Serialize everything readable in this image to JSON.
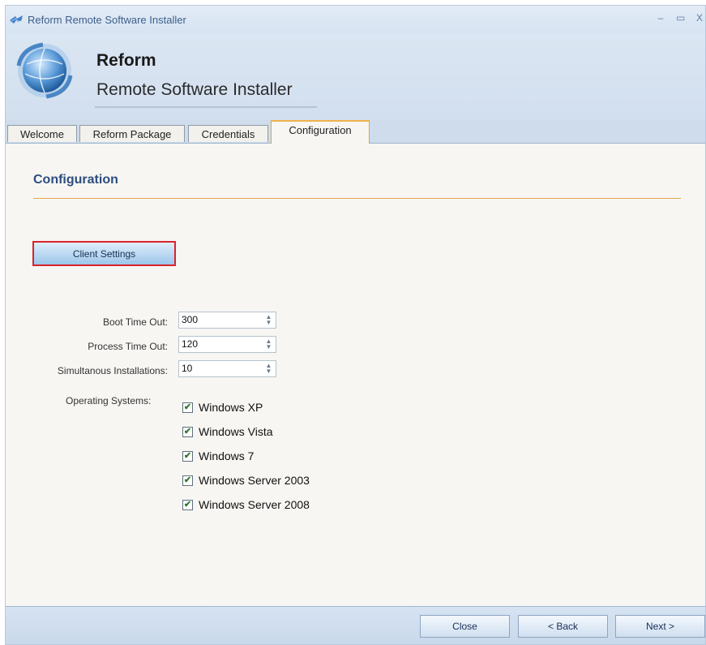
{
  "window": {
    "title": "Reform Remote Software Installer",
    "controls": {
      "minimize": "–",
      "maximize": "▭",
      "close": "X"
    }
  },
  "banner": {
    "app_name": "Reform",
    "subtitle": "Remote Software Installer"
  },
  "tabs": [
    {
      "label": "Welcome",
      "active": false
    },
    {
      "label": "Reform Package",
      "active": false
    },
    {
      "label": "Credentials",
      "active": false
    },
    {
      "label": "Configuration",
      "active": true
    }
  ],
  "page": {
    "title": "Configuration",
    "client_settings_label": "Client Settings"
  },
  "fields": {
    "boot_timeout": {
      "label": "Boot Time Out:",
      "value": "300"
    },
    "process_timeout": {
      "label": "Process Time Out:",
      "value": "120"
    },
    "simultaneous": {
      "label": "Simultanous Installations:",
      "value": "10"
    }
  },
  "os": {
    "label": "Operating Systems:",
    "items": [
      {
        "label": "Windows XP",
        "checked": true
      },
      {
        "label": "Windows Vista",
        "checked": true
      },
      {
        "label": "Windows 7",
        "checked": true
      },
      {
        "label": "Windows Server 2003",
        "checked": true
      },
      {
        "label": "Windows Server 2008",
        "checked": true
      }
    ]
  },
  "footer": {
    "close_label": "Close",
    "back_label": "< Back",
    "next_label": "Next >"
  },
  "colors": {
    "accent_orange": "#e6a64a",
    "title_blue": "#2c4d7e",
    "highlight_red": "#d9232d"
  }
}
